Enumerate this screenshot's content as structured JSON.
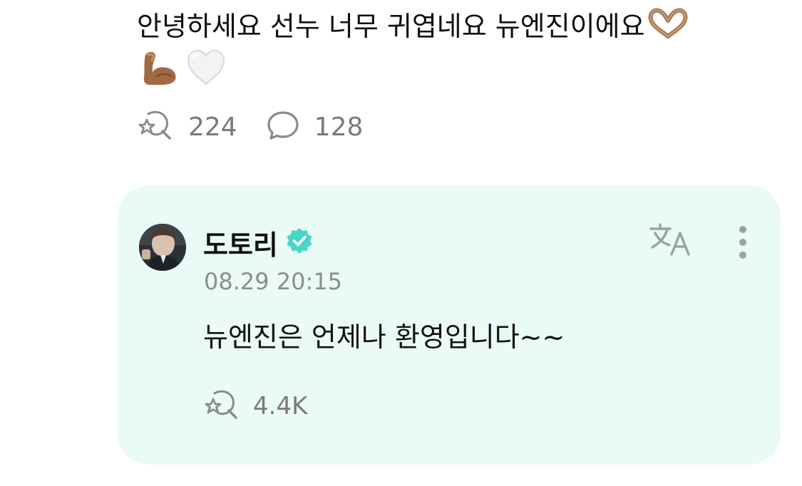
{
  "post": {
    "text": "안녕하세요 선누 너무 귀엽네요 뉴엔진이에요",
    "emojis": [
      "heart-hands-icon",
      "flexed-biceps-icon",
      "white-heart-icon"
    ],
    "like_count": "224",
    "comment_count": "128"
  },
  "reply": {
    "author_name": "도토리",
    "verified": true,
    "timestamp": "08.29 20:15",
    "text": "뉴엔진은 언제나 환영입니다~~",
    "like_count": "4.4K"
  },
  "colors": {
    "card_background": "#eafaf6",
    "verified_badge": "#49d6c6",
    "icon_gray": "#8a8a8a",
    "translate_icon": "#9aa3a1"
  }
}
